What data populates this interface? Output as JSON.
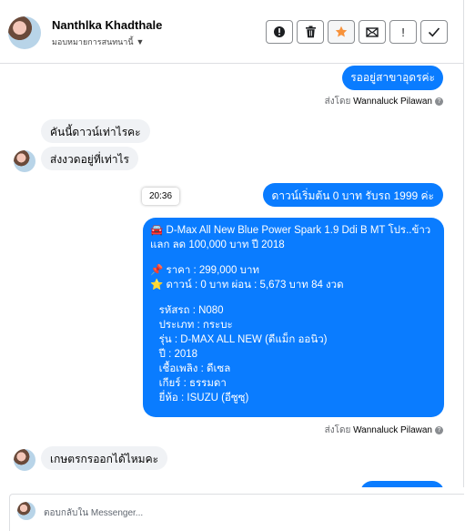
{
  "header": {
    "contact_name": "Nanthlka Khadthale",
    "assign_label": "มอบหมายการสนทนานี้",
    "toolbar": {
      "important_label": "!",
      "icons": [
        "alert-circle-icon",
        "trash-icon",
        "star-icon",
        "mark-unread-icon",
        "exclamation-icon",
        "check-icon"
      ]
    }
  },
  "colors": {
    "outgoing_bubble": "#0a7cff",
    "incoming_bubble": "#f0f2f5",
    "star": "#f7923b"
  },
  "thread": {
    "msg1": "รออยู่สาขาอุดรค่ะ",
    "sentby1_prefix": "ส่งโดย",
    "sentby1_name": "Wannaluck Pilawan",
    "msg2": "คันนี้ดาวน์เท่าไรคะ",
    "msg3": "ส่งงวดอยู่ที่เท่าไร",
    "time_tip": "20:36",
    "msg4": "ดาวน์เริ่มต้น 0 บาท รับรถ 1999 ค่ะ",
    "msg5": {
      "line1": "🚘 D-Max All New Blue Power Spark 1.9 Ddi B MT โปร..ข้าว",
      "line2": "แลก ลด 100,000 บาท ปี 2018",
      "line3": "📌 ราคา : 299,000 บาท",
      "line4": "⭐ ดาวน์ : 0 บาท ผ่อน : 5,673 บาท 84 งวด",
      "line5": "   รหัสรถ : N080",
      "line6": "   ประเภท : กระบะ",
      "line7": "   รุ่น : D-MAX ALL NEW (ดีแม็ก ออนิว)",
      "line8": "   ปี : 2018",
      "line9": "   เชื้อเพลิง : ดีเซล",
      "line10": "   เกียร์ : ธรรมดา",
      "line11": "   ยี่ห้อ : ISUZU (อีซูซุ)"
    },
    "sentby2_prefix": "ส่งโดย",
    "sentby2_name": "Wannaluck Pilawan",
    "msg6": "เกษตรกรออกได้ไหมคะ"
  },
  "composer": {
    "placeholder": "ตอบกลับใน Messenger..."
  }
}
